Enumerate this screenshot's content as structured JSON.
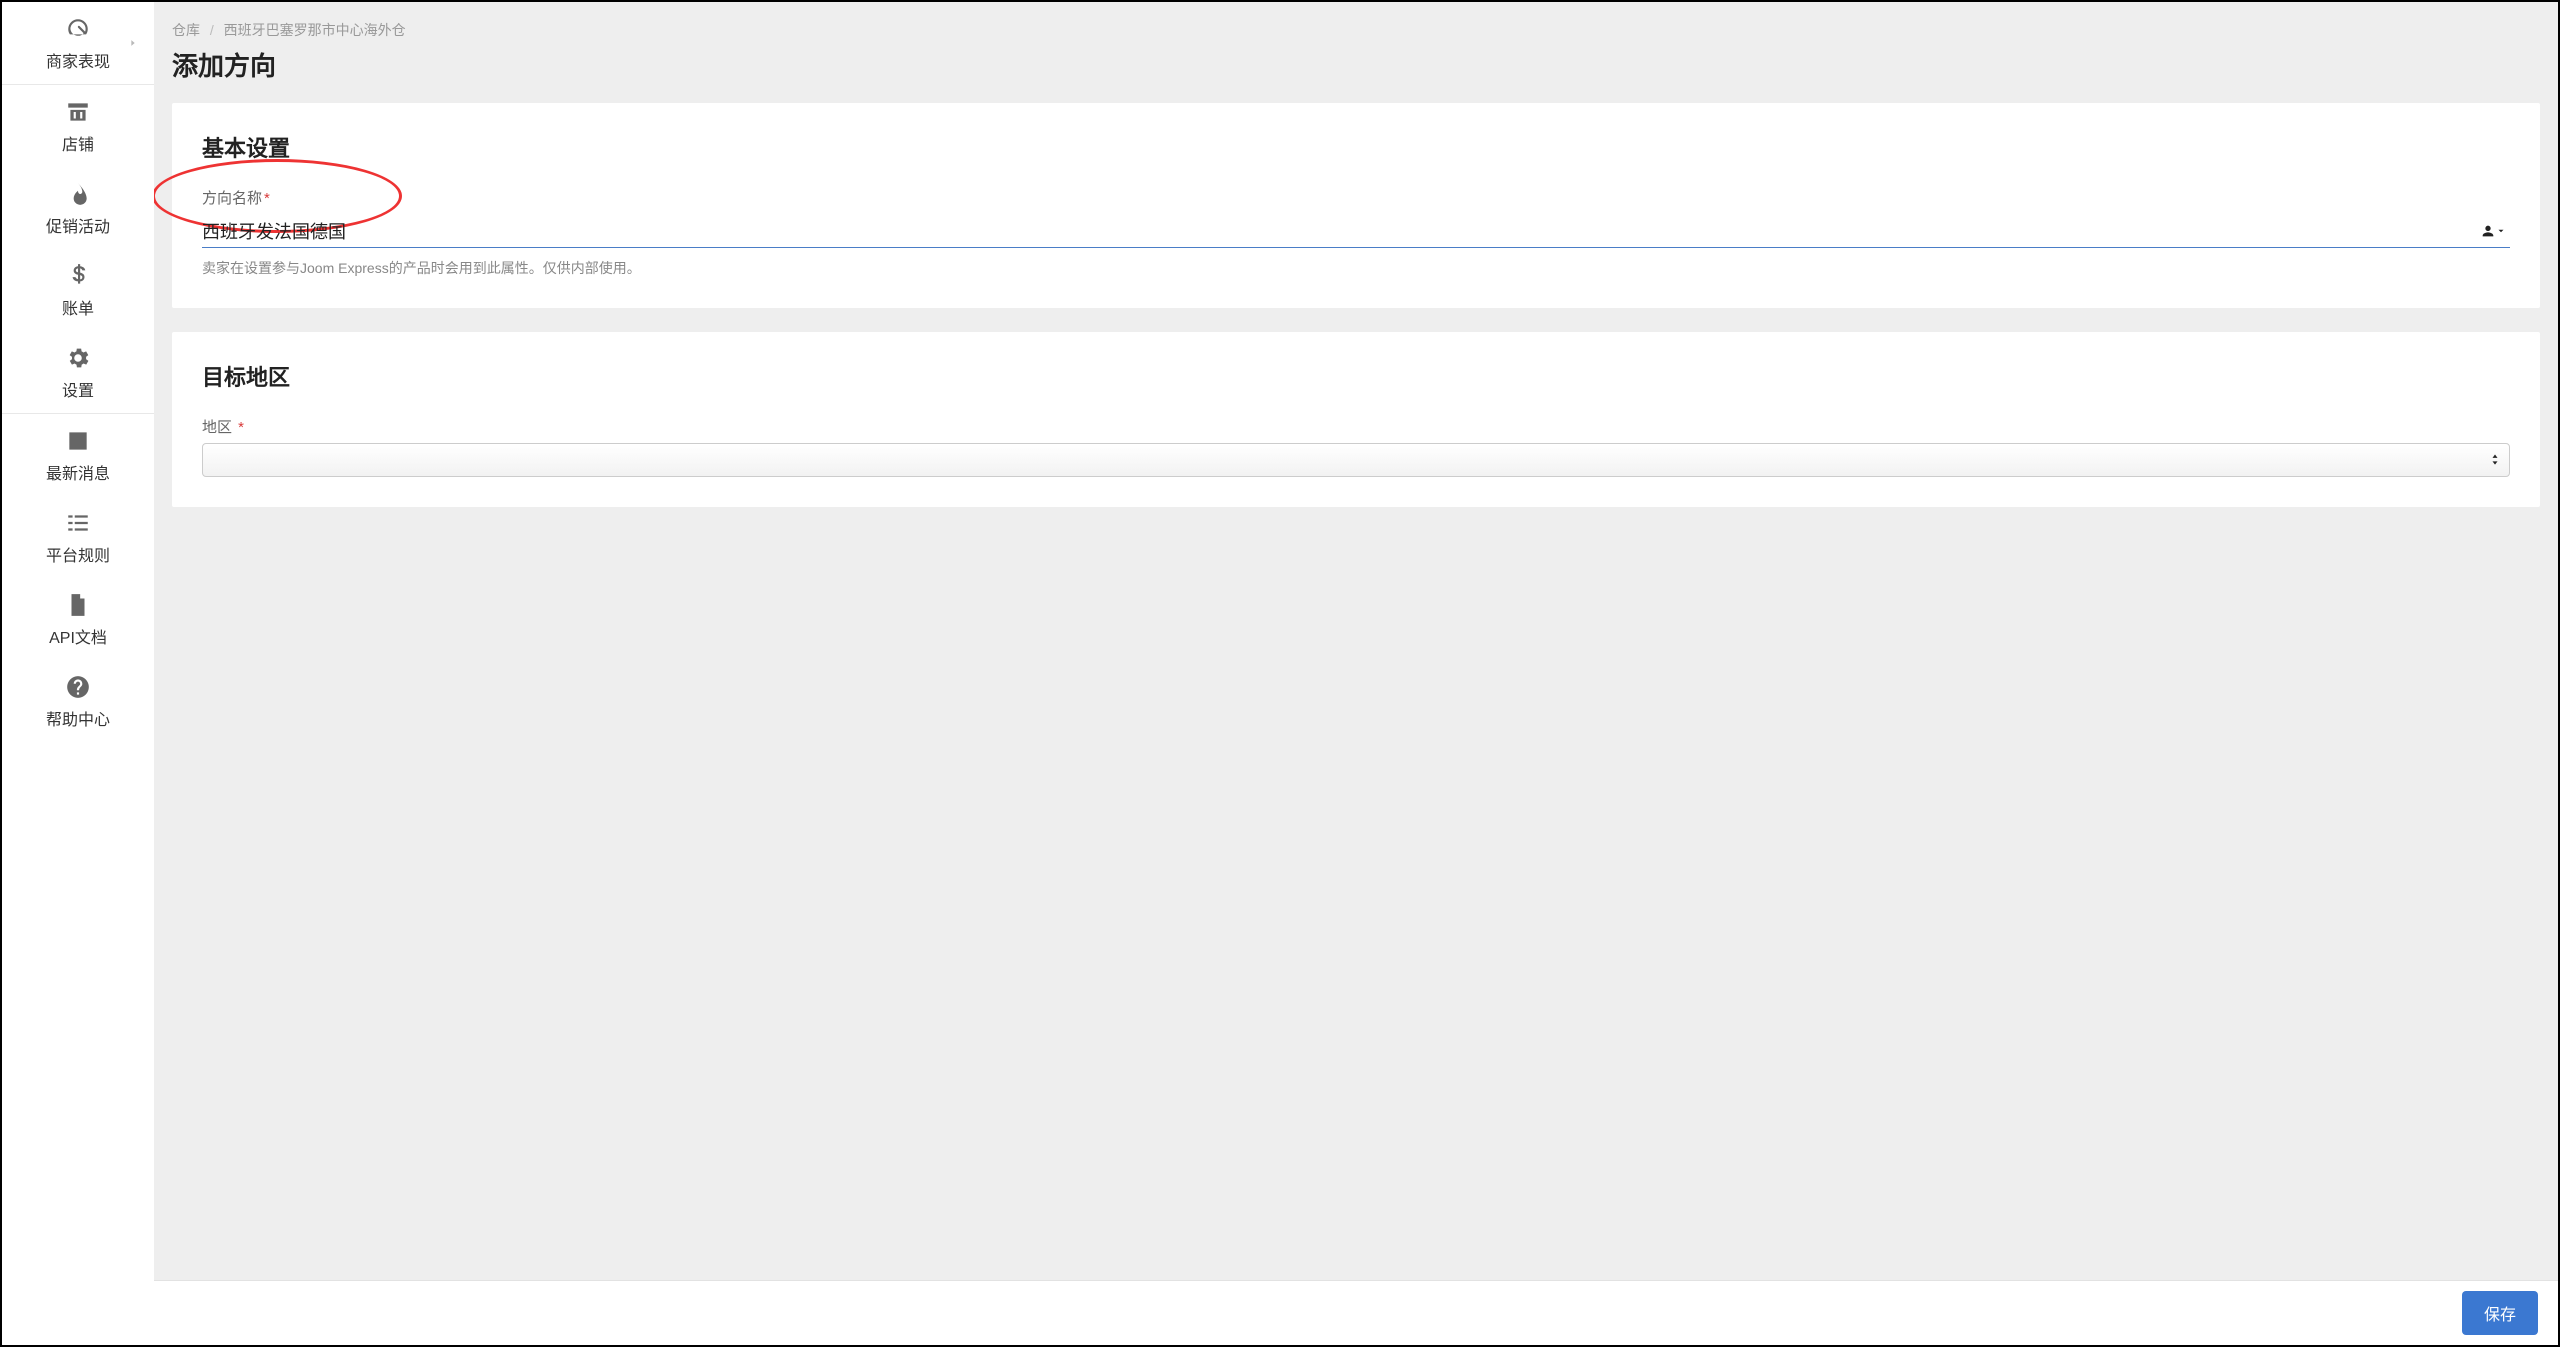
{
  "sidebar": {
    "items": [
      {
        "label": "商家表现"
      },
      {
        "label": "店铺"
      },
      {
        "label": "促销活动"
      },
      {
        "label": "账单"
      },
      {
        "label": "设置"
      },
      {
        "label": "最新消息"
      },
      {
        "label": "平台规则"
      },
      {
        "label": "API文档"
      },
      {
        "label": "帮助中心"
      }
    ]
  },
  "breadcrumb": {
    "root": "仓库",
    "current": "西班牙巴塞罗那市中心海外仓"
  },
  "page": {
    "title": "添加方向"
  },
  "basic": {
    "card_title": "基本设置",
    "name_label": "方向名称",
    "name_value": "西班牙发法国德国",
    "name_help": "卖家在设置参与Joom Express的产品时会用到此属性。仅供内部使用。"
  },
  "target": {
    "card_title": "目标地区",
    "region_label": "地区",
    "region_value": ""
  },
  "footer": {
    "save_label": "保存"
  }
}
